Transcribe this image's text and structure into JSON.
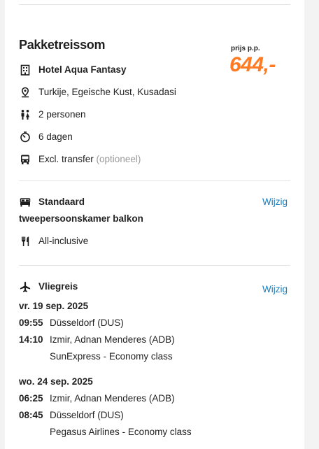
{
  "package": {
    "title": "Pakketreissom",
    "price_label": "prijs p.p.",
    "price": "644,-",
    "hotel": "Hotel Aqua Fantasy",
    "location": "Turkije, Egeische Kust, Kusadasi",
    "persons": "2 personen",
    "duration": "6 dagen",
    "transfer": "Excl. transfer",
    "transfer_note": "(optioneel)"
  },
  "room": {
    "type": "Standaard",
    "name": "tweepersoonskamer balkon",
    "board": "All-inclusive",
    "edit_label": "Wijzig"
  },
  "flight": {
    "title": "Vliegreis",
    "edit_label": "Wijzig",
    "outbound": {
      "date": "vr. 19 sep. 2025",
      "dep_time": "09:55",
      "dep_airport": "Düsseldorf (DUS)",
      "arr_time": "14:10",
      "arr_airport": "Izmir, Adnan Menderes (ADB)",
      "carrier": "SunExpress",
      "separator": "-",
      "cabin": "Economy class"
    },
    "return": {
      "date": "wo. 24 sep. 2025",
      "dep_time": "06:25",
      "dep_airport": "Izmir, Adnan Menderes (ADB)",
      "arr_time": "08:45",
      "arr_airport": "Düsseldorf (DUS)",
      "carrier": "Pegasus Airlines",
      "separator": "-",
      "cabin": "Economy class"
    }
  },
  "colors": {
    "accent": "#ff7a21",
    "link": "#1a7fc1"
  },
  "icons": [
    "building-icon",
    "location-pin-icon",
    "persons-icon",
    "timer-icon",
    "bus-icon",
    "bed-icon",
    "cutlery-icon",
    "airplane-icon"
  ]
}
